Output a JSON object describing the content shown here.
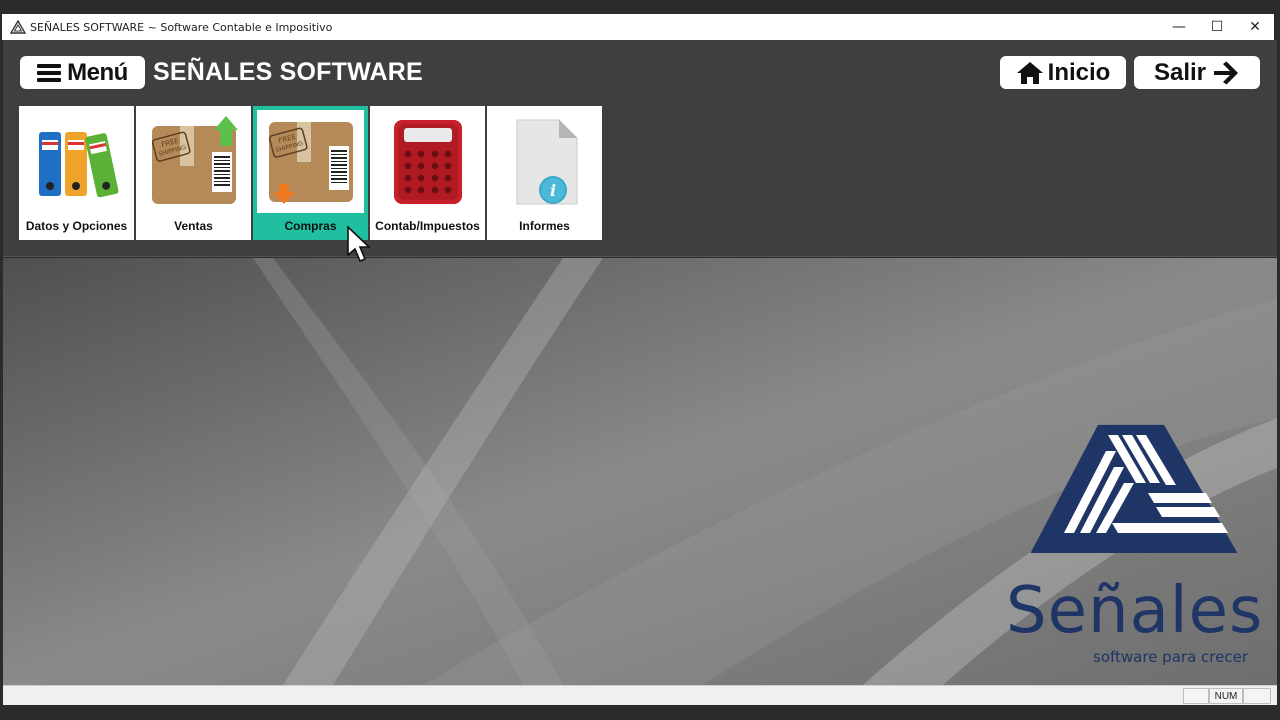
{
  "window": {
    "title": "SEÑALES SOFTWARE ~ Software Contable e Impositivo",
    "controls": [
      "—",
      "☐",
      "✕"
    ]
  },
  "header": {
    "menu_label": "Menú",
    "brand": "SEÑALES SOFTWARE",
    "inicio_label": "Inicio",
    "salir_label": "Salir"
  },
  "tiles": [
    {
      "label": "Datos y Opciones",
      "icon": "binders-icon",
      "active": false
    },
    {
      "label": "Ventas",
      "icon": "package-upload-icon",
      "active": false
    },
    {
      "label": "Compras",
      "icon": "package-download-icon",
      "active": true
    },
    {
      "label": "Contab/Impuestos",
      "icon": "calculator-icon",
      "active": false
    },
    {
      "label": "Informes",
      "icon": "document-info-icon",
      "active": false
    }
  ],
  "logo": {
    "name": "Señales",
    "tagline": "software para crecer"
  },
  "statusbar": {
    "num": "NUM"
  },
  "colors": {
    "accent": "#1fbfa0",
    "logo_blue": "#1e3566",
    "header_bg": "#3f3f3f"
  }
}
